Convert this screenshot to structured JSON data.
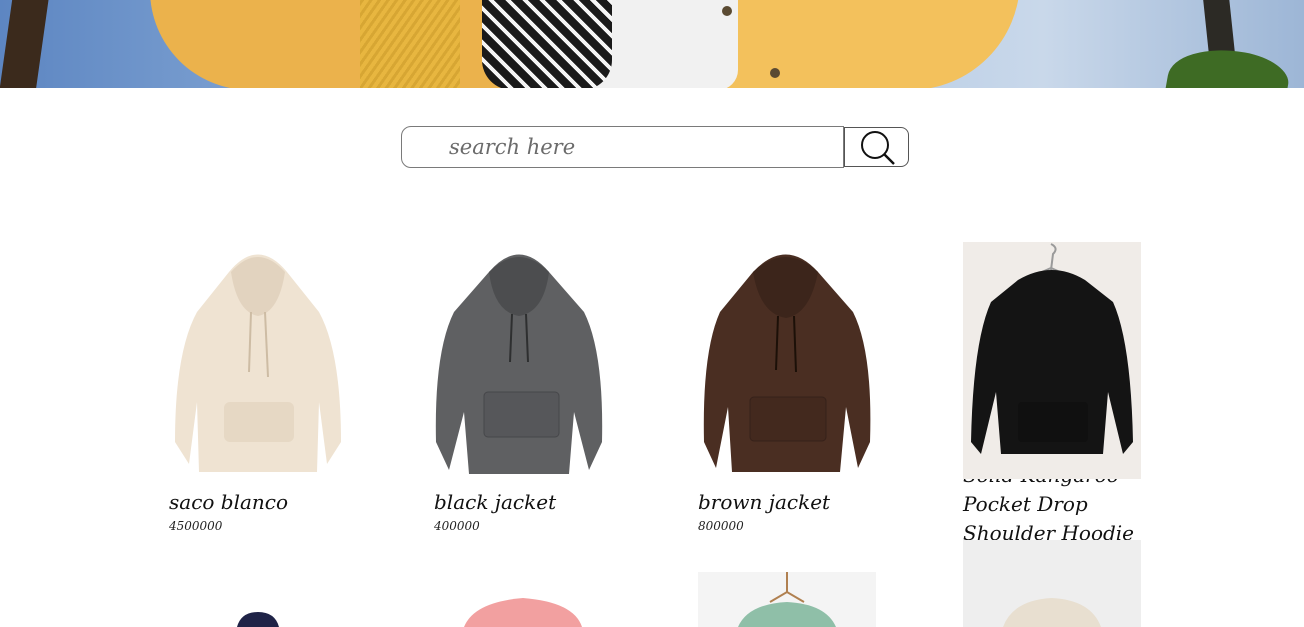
{
  "search": {
    "placeholder": "search here",
    "button_icon": "search-icon"
  },
  "products": [
    {
      "name": "saco blanco",
      "price": "4500000",
      "color": "#efe3d2"
    },
    {
      "name": "black jacket",
      "price": "400000",
      "color": "#5f6062"
    },
    {
      "name": "brown jacket",
      "price": "800000",
      "color": "#4a2e22"
    },
    {
      "name": "Solid Kangaroo Pocket Drop Shoulder Hoodie",
      "price": "",
      "color": "#141414"
    }
  ],
  "products_row2": [
    {
      "color": "#1f2347"
    },
    {
      "color": "#f2a0a0"
    },
    {
      "color": "#8fbfa8"
    },
    {
      "color": "#e8dfd0"
    }
  ]
}
